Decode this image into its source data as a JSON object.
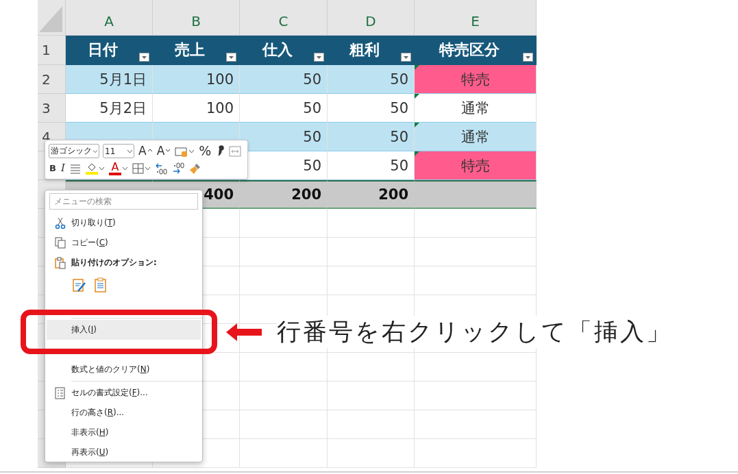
{
  "sheet": {
    "columns": [
      "A",
      "B",
      "C",
      "D",
      "E"
    ],
    "row_numbers": [
      "1",
      "2",
      "3",
      "4"
    ],
    "table_headers": [
      "日付",
      "売上",
      "仕入",
      "粗利",
      "特売区分"
    ],
    "rows": [
      {
        "banded": true,
        "date": "5月1日",
        "sales": "100",
        "cost": "50",
        "profit": "50",
        "type": "特売",
        "color": "#ff5c8d",
        "error_mark": true
      },
      {
        "banded": false,
        "date": "5月2日",
        "sales": "100",
        "cost": "50",
        "profit": "50",
        "type": "通常",
        "error_mark": true
      },
      {
        "banded": true,
        "cost": "50",
        "profit": "50",
        "type": "通常",
        "error_mark": true
      },
      {
        "banded": false,
        "cost": "50",
        "profit": "50",
        "type": "特売",
        "color": "#ff5c8d",
        "error_mark": true
      }
    ],
    "total_row": {
      "sales": "400",
      "cost": "200",
      "profit": "200"
    }
  },
  "mini_toolbar": {
    "font_controls": [
      {
        "kind": "font",
        "value": "游ゴシック"
      },
      {
        "kind": "size",
        "value": "11"
      },
      {
        "kind": "grow",
        "glyph": "A"
      },
      {
        "kind": "shrink",
        "glyph": "A"
      },
      {
        "kind": "number-format"
      },
      {
        "kind": "percent",
        "glyph": "%"
      },
      {
        "kind": "comma"
      },
      {
        "kind": "merge"
      }
    ],
    "format_controls": [
      {
        "kind": "bold",
        "glyph": "B"
      },
      {
        "kind": "italic",
        "glyph": "I"
      },
      {
        "kind": "align"
      },
      {
        "kind": "fill",
        "color": "#ffeb00"
      },
      {
        "kind": "font-color",
        "glyph": "A",
        "color": "#e00000"
      },
      {
        "kind": "borders"
      },
      {
        "kind": "inc-decimal"
      },
      {
        "kind": "dec-decimal"
      },
      {
        "kind": "brush"
      }
    ]
  },
  "context_menu": {
    "search": {
      "placeholder": "メニューの検索"
    },
    "items": [
      {
        "kind": "cut",
        "label": "切り取り(",
        "key": "T",
        "after": ")",
        "selected": false
      },
      {
        "kind": "copy",
        "label": "コピー(",
        "key": "C",
        "after": ")",
        "selected": false
      },
      {
        "kind": "paste-heading",
        "label": "貼り付けのオプション:"
      },
      {
        "kind": "paste-icons"
      },
      {
        "kind": "gap"
      },
      {
        "kind": "separator"
      },
      {
        "kind": "item",
        "label": "挿入(",
        "key": "I",
        "after": ")",
        "selected": true
      },
      {
        "kind": "gap"
      },
      {
        "kind": "item",
        "label": "数式と値のクリア(",
        "key": "N",
        "after": ")",
        "selected": false
      },
      {
        "kind": "separator"
      },
      {
        "kind": "format-cells",
        "label": "セルの書式設定(",
        "key": "F",
        "after": ")...",
        "selected": false
      },
      {
        "kind": "item",
        "label": "行の高さ(",
        "key": "R",
        "after": ")...",
        "selected": false
      },
      {
        "kind": "item",
        "label": "非表示(",
        "key": "H",
        "after": ")",
        "selected": false
      },
      {
        "kind": "item",
        "label": "再表示(",
        "key": "U",
        "after": ")",
        "selected": false
      }
    ]
  },
  "annotation": {
    "text": "行番号を右クリックして「挿入」"
  }
}
